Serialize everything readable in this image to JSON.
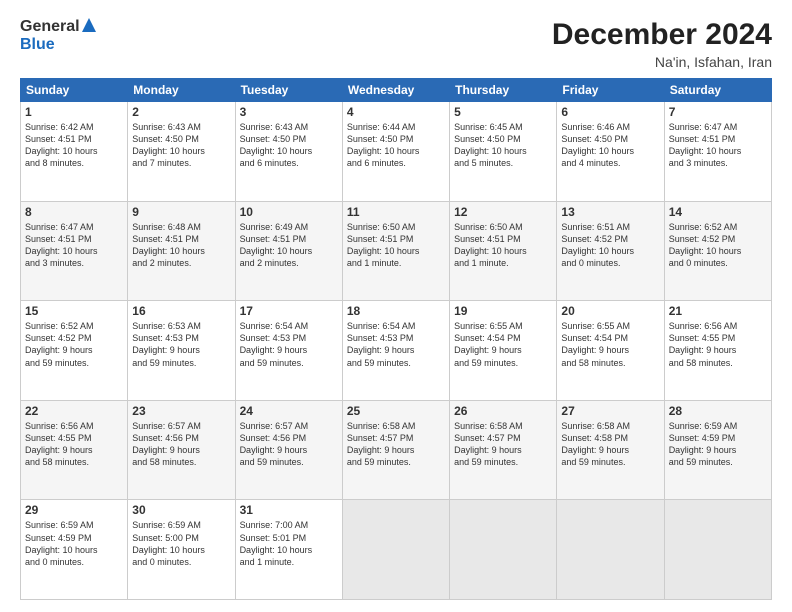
{
  "header": {
    "logo_general": "General",
    "logo_blue": "Blue",
    "month_title": "December 2024",
    "location": "Na'in, Isfahan, Iran"
  },
  "weekdays": [
    "Sunday",
    "Monday",
    "Tuesday",
    "Wednesday",
    "Thursday",
    "Friday",
    "Saturday"
  ],
  "weeks": [
    [
      {
        "day": "1",
        "info": "Sunrise: 6:42 AM\nSunset: 4:51 PM\nDaylight: 10 hours\nand 8 minutes."
      },
      {
        "day": "2",
        "info": "Sunrise: 6:43 AM\nSunset: 4:50 PM\nDaylight: 10 hours\nand 7 minutes."
      },
      {
        "day": "3",
        "info": "Sunrise: 6:43 AM\nSunset: 4:50 PM\nDaylight: 10 hours\nand 6 minutes."
      },
      {
        "day": "4",
        "info": "Sunrise: 6:44 AM\nSunset: 4:50 PM\nDaylight: 10 hours\nand 6 minutes."
      },
      {
        "day": "5",
        "info": "Sunrise: 6:45 AM\nSunset: 4:50 PM\nDaylight: 10 hours\nand 5 minutes."
      },
      {
        "day": "6",
        "info": "Sunrise: 6:46 AM\nSunset: 4:50 PM\nDaylight: 10 hours\nand 4 minutes."
      },
      {
        "day": "7",
        "info": "Sunrise: 6:47 AM\nSunset: 4:51 PM\nDaylight: 10 hours\nand 3 minutes."
      }
    ],
    [
      {
        "day": "8",
        "info": "Sunrise: 6:47 AM\nSunset: 4:51 PM\nDaylight: 10 hours\nand 3 minutes."
      },
      {
        "day": "9",
        "info": "Sunrise: 6:48 AM\nSunset: 4:51 PM\nDaylight: 10 hours\nand 2 minutes."
      },
      {
        "day": "10",
        "info": "Sunrise: 6:49 AM\nSunset: 4:51 PM\nDaylight: 10 hours\nand 2 minutes."
      },
      {
        "day": "11",
        "info": "Sunrise: 6:50 AM\nSunset: 4:51 PM\nDaylight: 10 hours\nand 1 minute."
      },
      {
        "day": "12",
        "info": "Sunrise: 6:50 AM\nSunset: 4:51 PM\nDaylight: 10 hours\nand 1 minute."
      },
      {
        "day": "13",
        "info": "Sunrise: 6:51 AM\nSunset: 4:52 PM\nDaylight: 10 hours\nand 0 minutes."
      },
      {
        "day": "14",
        "info": "Sunrise: 6:52 AM\nSunset: 4:52 PM\nDaylight: 10 hours\nand 0 minutes."
      }
    ],
    [
      {
        "day": "15",
        "info": "Sunrise: 6:52 AM\nSunset: 4:52 PM\nDaylight: 9 hours\nand 59 minutes."
      },
      {
        "day": "16",
        "info": "Sunrise: 6:53 AM\nSunset: 4:53 PM\nDaylight: 9 hours\nand 59 minutes."
      },
      {
        "day": "17",
        "info": "Sunrise: 6:54 AM\nSunset: 4:53 PM\nDaylight: 9 hours\nand 59 minutes."
      },
      {
        "day": "18",
        "info": "Sunrise: 6:54 AM\nSunset: 4:53 PM\nDaylight: 9 hours\nand 59 minutes."
      },
      {
        "day": "19",
        "info": "Sunrise: 6:55 AM\nSunset: 4:54 PM\nDaylight: 9 hours\nand 59 minutes."
      },
      {
        "day": "20",
        "info": "Sunrise: 6:55 AM\nSunset: 4:54 PM\nDaylight: 9 hours\nand 58 minutes."
      },
      {
        "day": "21",
        "info": "Sunrise: 6:56 AM\nSunset: 4:55 PM\nDaylight: 9 hours\nand 58 minutes."
      }
    ],
    [
      {
        "day": "22",
        "info": "Sunrise: 6:56 AM\nSunset: 4:55 PM\nDaylight: 9 hours\nand 58 minutes."
      },
      {
        "day": "23",
        "info": "Sunrise: 6:57 AM\nSunset: 4:56 PM\nDaylight: 9 hours\nand 58 minutes."
      },
      {
        "day": "24",
        "info": "Sunrise: 6:57 AM\nSunset: 4:56 PM\nDaylight: 9 hours\nand 59 minutes."
      },
      {
        "day": "25",
        "info": "Sunrise: 6:58 AM\nSunset: 4:57 PM\nDaylight: 9 hours\nand 59 minutes."
      },
      {
        "day": "26",
        "info": "Sunrise: 6:58 AM\nSunset: 4:57 PM\nDaylight: 9 hours\nand 59 minutes."
      },
      {
        "day": "27",
        "info": "Sunrise: 6:58 AM\nSunset: 4:58 PM\nDaylight: 9 hours\nand 59 minutes."
      },
      {
        "day": "28",
        "info": "Sunrise: 6:59 AM\nSunset: 4:59 PM\nDaylight: 9 hours\nand 59 minutes."
      }
    ],
    [
      {
        "day": "29",
        "info": "Sunrise: 6:59 AM\nSunset: 4:59 PM\nDaylight: 10 hours\nand 0 minutes."
      },
      {
        "day": "30",
        "info": "Sunrise: 6:59 AM\nSunset: 5:00 PM\nDaylight: 10 hours\nand 0 minutes."
      },
      {
        "day": "31",
        "info": "Sunrise: 7:00 AM\nSunset: 5:01 PM\nDaylight: 10 hours\nand 1 minute."
      },
      {
        "day": "",
        "info": ""
      },
      {
        "day": "",
        "info": ""
      },
      {
        "day": "",
        "info": ""
      },
      {
        "day": "",
        "info": ""
      }
    ]
  ]
}
